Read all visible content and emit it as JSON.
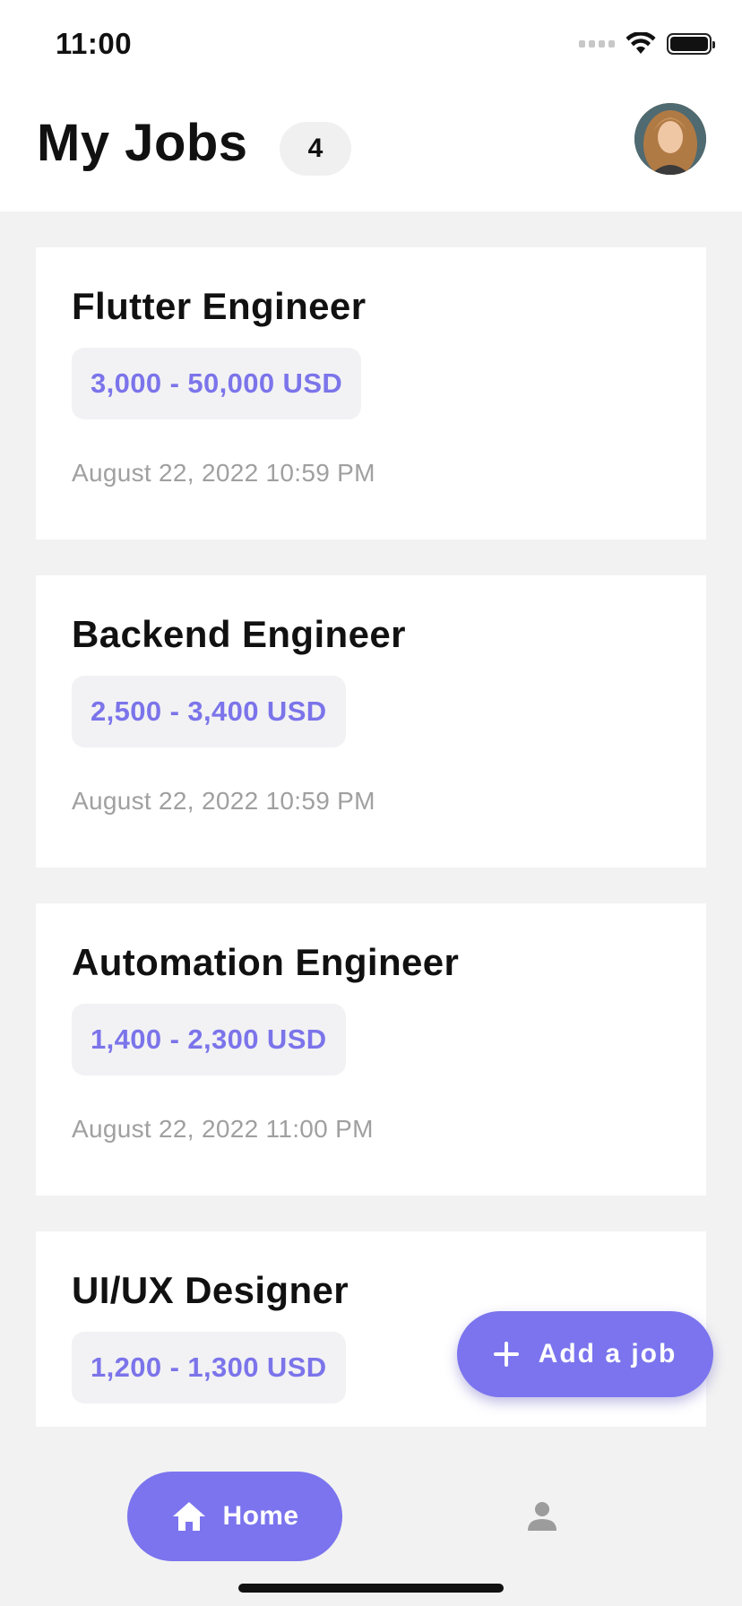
{
  "status_bar": {
    "time": "11:00"
  },
  "header": {
    "title": "My Jobs",
    "job_count": "4"
  },
  "jobs": [
    {
      "title": "Flutter Engineer",
      "salary": "3,000 - 50,000 USD",
      "date": "August 22, 2022 10:59 PM"
    },
    {
      "title": "Backend Engineer",
      "salary": "2,500 - 3,400 USD",
      "date": "August 22, 2022 10:59 PM"
    },
    {
      "title": "Automation Engineer",
      "salary": "1,400 - 2,300 USD",
      "date": "August 22, 2022 11:00 PM"
    },
    {
      "title": "UI/UX Designer",
      "salary": "1,200 - 1,300 USD",
      "date": ""
    }
  ],
  "fab": {
    "label": "Add a job",
    "icon": "plus-icon"
  },
  "bottom_nav": {
    "items": [
      {
        "label": "Home",
        "icon": "home-icon",
        "active": true
      },
      {
        "label": "",
        "icon": "person-icon",
        "active": false
      }
    ]
  },
  "colors": {
    "accent": "#7b74ee",
    "salary_text": "#7b74ea",
    "chip_bg": "#f2f2f4",
    "date_text": "#a0a0a0",
    "background": "#f2f2f2"
  }
}
